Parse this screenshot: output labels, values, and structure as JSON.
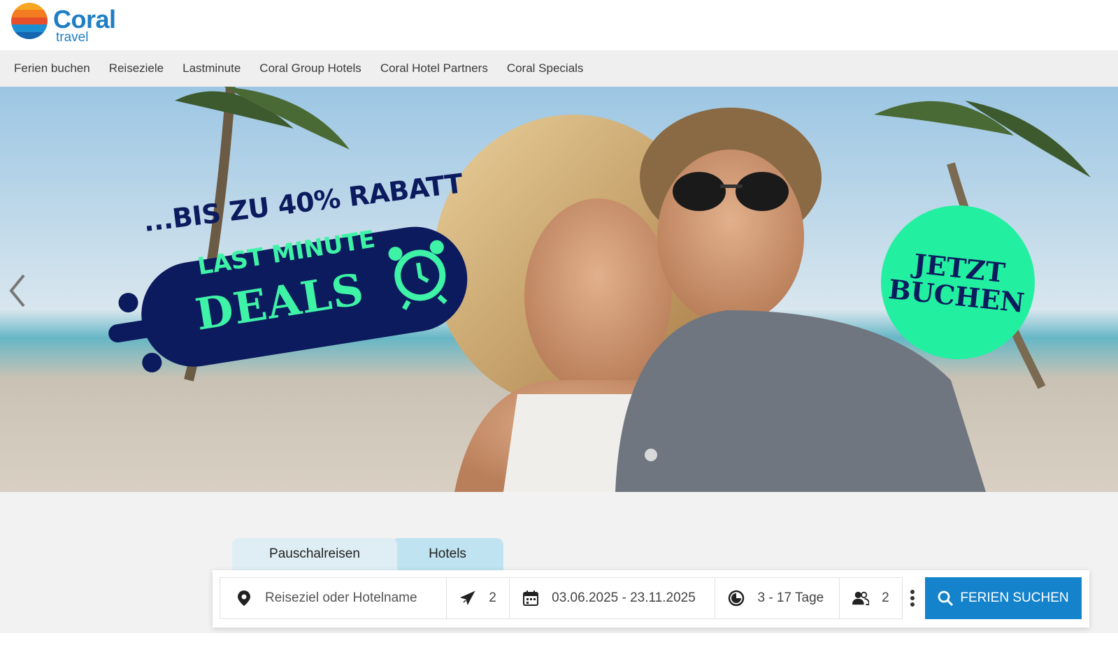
{
  "brand": {
    "name": "Coral",
    "sub": "travel",
    "colors": {
      "primary": "#1e7ec4",
      "logo_stripes": [
        "#f6a623",
        "#f27c1f",
        "#e8502c",
        "#1b8fd2",
        "#1565b0"
      ]
    }
  },
  "nav": {
    "items": [
      {
        "label": "Ferien buchen"
      },
      {
        "label": "Reiseziele"
      },
      {
        "label": "Lastminute"
      },
      {
        "label": "Coral Group Hotels"
      },
      {
        "label": "Coral Hotel Partners"
      },
      {
        "label": "Coral Specials"
      }
    ]
  },
  "hero": {
    "headline_top": "...BIS ZU 40% RABATT",
    "headline_line1": "LAST MINUTE",
    "headline_line2": "DEALS",
    "cta_line1": "JETZT",
    "cta_line2": "BUCHEN",
    "icons": {
      "prev": "chevron-left-icon",
      "alarm": "alarm-clock-icon"
    },
    "colors": {
      "banner": "#0c1a5e",
      "accent": "#3ef2a6",
      "cta": "#22f0a0"
    }
  },
  "search": {
    "tabs": [
      {
        "label": "Pauschalreisen",
        "active": true
      },
      {
        "label": "Hotels",
        "active": false
      }
    ],
    "destination_placeholder": "Reiseziel oder Hotelname",
    "flights": "2",
    "dates": "03.06.2025 - 23.11.2025",
    "duration": "3 - 17 Tage",
    "persons": "2",
    "button_label": "FERIEN SUCHEN",
    "icons": {
      "destination": "map-pin-icon",
      "flight": "airplane-icon",
      "date": "calendar-icon",
      "duration": "duration-clock-icon",
      "persons": "people-icon",
      "more": "more-vertical-icon",
      "search": "search-icon"
    },
    "colors": {
      "button": "#1483cc"
    }
  }
}
